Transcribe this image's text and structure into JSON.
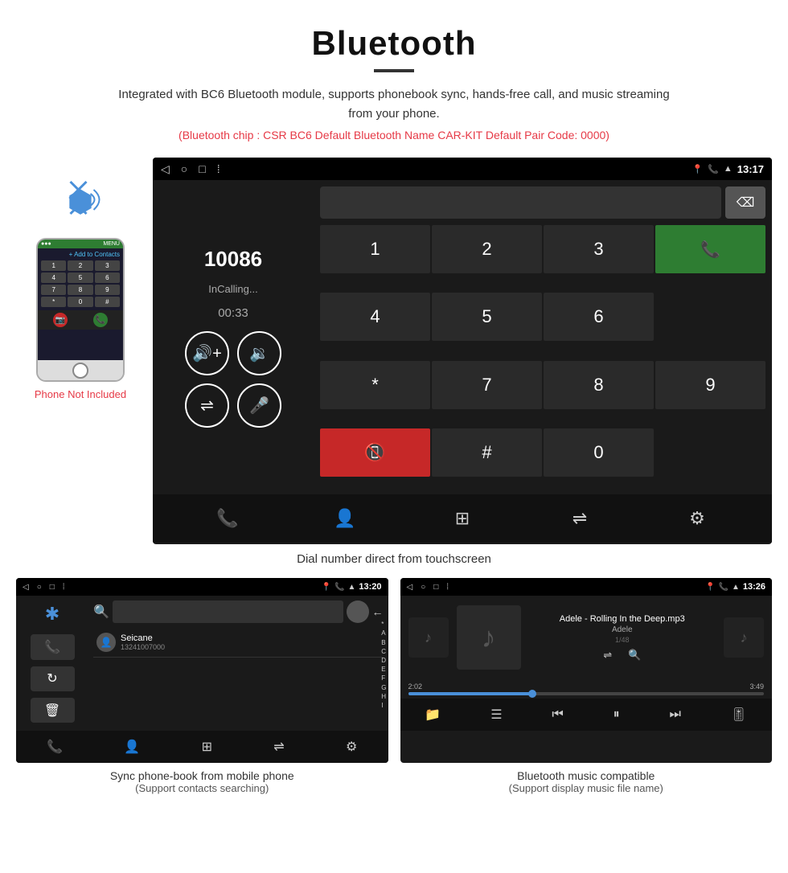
{
  "header": {
    "title": "Bluetooth",
    "description": "Integrated with BC6 Bluetooth module, supports phonebook sync, hands-free call, and music streaming from your phone.",
    "specs": "(Bluetooth chip : CSR BC6    Default Bluetooth Name CAR-KIT    Default Pair Code: 0000)"
  },
  "phone_label": "Phone Not Included",
  "dial_caption": "Dial number direct from touchscreen",
  "dialer": {
    "number": "10086",
    "status": "InCalling...",
    "timer": "00:33",
    "time": "13:17",
    "keys": [
      "1",
      "2",
      "3",
      "*",
      "4",
      "5",
      "6",
      "0",
      "7",
      "8",
      "9",
      "#"
    ]
  },
  "phonebook": {
    "time": "13:20",
    "contact_name": "Seicane",
    "contact_number": "13241007000",
    "alphabet": [
      "*",
      "A",
      "B",
      "C",
      "D",
      "E",
      "F",
      "G",
      "H",
      "I"
    ]
  },
  "music": {
    "time": "13:26",
    "track": "Adele - Rolling In the Deep.mp3",
    "artist": "Adele",
    "track_count": "1/48",
    "time_current": "2:02",
    "time_total": "3:49"
  },
  "bottom_captions": {
    "phonebook": "Sync phone-book from mobile phone",
    "phonebook_sub": "(Support contacts searching)",
    "music": "Bluetooth music compatible",
    "music_sub": "(Support display music file name)"
  }
}
